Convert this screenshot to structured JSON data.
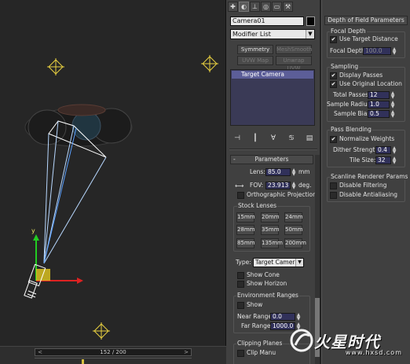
{
  "viewport": {
    "timeline": {
      "frame_text": "152 / 200",
      "prev_label": "<",
      "next_label": ">"
    },
    "gizmo_axis_label": "y"
  },
  "command_panel": {
    "tabs": [
      {
        "icon": "create-icon",
        "glyph": "✚"
      },
      {
        "icon": "modify-icon",
        "glyph": "◐"
      },
      {
        "icon": "hierarchy-icon",
        "glyph": "⊥"
      },
      {
        "icon": "motion-icon",
        "glyph": "◎"
      },
      {
        "icon": "display-icon",
        "glyph": "▭"
      },
      {
        "icon": "utilities-icon",
        "glyph": "⚒"
      }
    ],
    "object_name": "Camera01",
    "object_color": "#050505",
    "modifier_list": "Modifier List",
    "modifier_buttons": {
      "symmetry": "Symmetry",
      "meshsmooth": "MeshSmooth",
      "uvw_map": "UVW Map",
      "unwrap_uvw": "Unwrap UVW"
    },
    "stack_item": "Target Camera",
    "stack_tools": [
      "⊣",
      "┃",
      "∀",
      "♋",
      "▤"
    ],
    "parameters": {
      "rollout_title": "Parameters",
      "lens_label": "Lens:",
      "lens_value": "85.0",
      "lens_unit": "mm",
      "fov_label": "FOV:",
      "fov_value": "23.913",
      "fov_unit": "deg.",
      "fov_direction_icon": "⟷",
      "ortho_label": "Orthographic Projection",
      "stock_lenses_title": "Stock Lenses",
      "stock_lenses": [
        "15mm",
        "20mm",
        "24mm",
        "28mm",
        "35mm",
        "50mm",
        "85mm",
        "135mm",
        "200mm"
      ],
      "type_label": "Type:",
      "type_value": "Target Camera",
      "show_cone_label": "Show Cone",
      "show_horizon_label": "Show Horizon",
      "env_title": "Environment Ranges",
      "show_label": "Show",
      "near_label": "Near Range:",
      "near_value": "0.0",
      "far_label": "Far Range:",
      "far_value": "1000.0",
      "clipping_title": "Clipping Planes",
      "clip_manually_label": "Clip Manu"
    }
  },
  "dof_panel": {
    "rollout_title": "Depth of Field Parameters",
    "focal_depth_title": "Focal Depth",
    "use_target_distance": {
      "label": "Use Target Distance",
      "checked": true
    },
    "focal_depth_label": "Focal Depth:",
    "focal_depth_value": "100.0",
    "sampling_title": "Sampling",
    "display_passes": {
      "label": "Display Passes",
      "checked": true
    },
    "use_original_location": {
      "label": "Use Original Location",
      "checked": true
    },
    "total_passes_label": "Total Passes:",
    "total_passes_value": "12",
    "sample_radius_label": "Sample Radius:",
    "sample_radius_value": "1.0",
    "sample_bias_label": "Sample Bias:",
    "sample_bias_value": "0.5",
    "pass_blending_title": "Pass Blending",
    "normalize_weights": {
      "label": "Normalize Weights",
      "checked": true
    },
    "dither_label": "Dither Strength:",
    "dither_value": "0.4",
    "tile_label": "Tile Size:",
    "tile_value": "32",
    "scanline_title": "Scanline Renderer Params",
    "disable_filtering": {
      "label": "Disable Filtering",
      "checked": false
    },
    "disable_antialiasing": {
      "label": "Disable Antialiasing",
      "checked": false
    }
  },
  "watermark": {
    "cn_text": "火星时代",
    "url": "www.hxsd.com"
  }
}
